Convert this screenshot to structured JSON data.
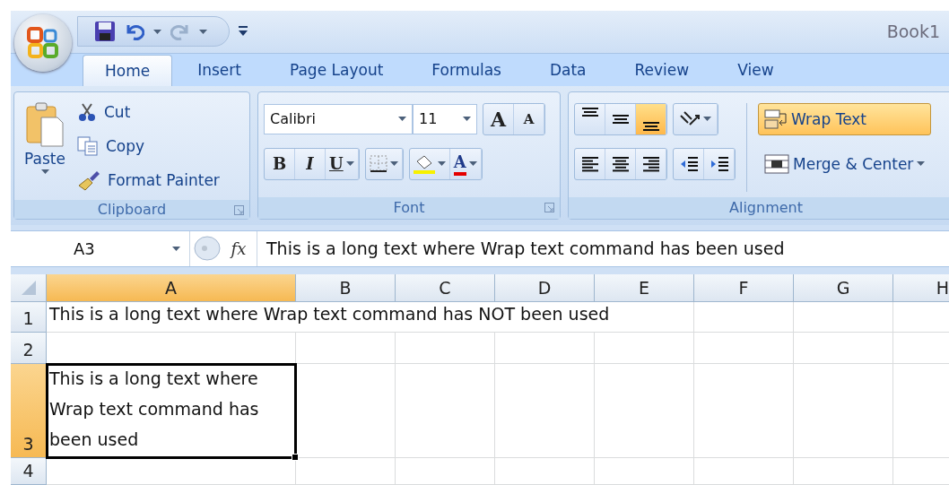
{
  "title_bar": {
    "title": "Book1"
  },
  "tabs": [
    {
      "label": "Home",
      "selected": true
    },
    {
      "label": "Insert",
      "selected": false
    },
    {
      "label": "Page Layout",
      "selected": false
    },
    {
      "label": "Formulas",
      "selected": false
    },
    {
      "label": "Data",
      "selected": false
    },
    {
      "label": "Review",
      "selected": false
    },
    {
      "label": "View",
      "selected": false
    }
  ],
  "clipboard": {
    "paste": "Paste",
    "cut": "Cut",
    "copy": "Copy",
    "format_painter": "Format Painter",
    "group_label": "Clipboard"
  },
  "font": {
    "font_name": "Calibri",
    "font_size": "11",
    "grow": "A",
    "shrink": "A",
    "bold": "B",
    "italic": "I",
    "underline": "U",
    "font_color": "A",
    "group_label": "Font"
  },
  "alignment": {
    "vertical_align": [
      {
        "kind": "top",
        "selected": false
      },
      {
        "kind": "middle",
        "selected": false
      },
      {
        "kind": "bottom",
        "selected": true
      }
    ],
    "wrap_text": {
      "label": "Wrap Text",
      "selected": true
    },
    "merge": {
      "label": "Merge & Center"
    },
    "group_label": "Alignment"
  },
  "formula_bar": {
    "name_box": "A3",
    "function_label": "fx",
    "value": "This is a long text where Wrap text command has  been used"
  },
  "sheet": {
    "columns": [
      {
        "label": "A",
        "selected": true
      },
      {
        "label": "B",
        "selected": false
      },
      {
        "label": "C",
        "selected": false
      },
      {
        "label": "D",
        "selected": false
      },
      {
        "label": "E",
        "selected": false
      },
      {
        "label": "F",
        "selected": false
      },
      {
        "label": "G",
        "selected": false
      },
      {
        "label": "H",
        "selected": false
      }
    ],
    "rows": [
      {
        "label": "1",
        "selected": false,
        "kind": "overflow",
        "text": "This is a long text where Wrap text command has NOT been used",
        "active": false
      },
      {
        "label": "2",
        "selected": false,
        "kind": "empty",
        "active": false
      },
      {
        "label": "3",
        "selected": true,
        "kind": "wrapped",
        "text": "This is a long text where Wrap text command has been used",
        "active": true
      },
      {
        "label": "4",
        "selected": false,
        "kind": "empty",
        "active": false
      }
    ]
  }
}
